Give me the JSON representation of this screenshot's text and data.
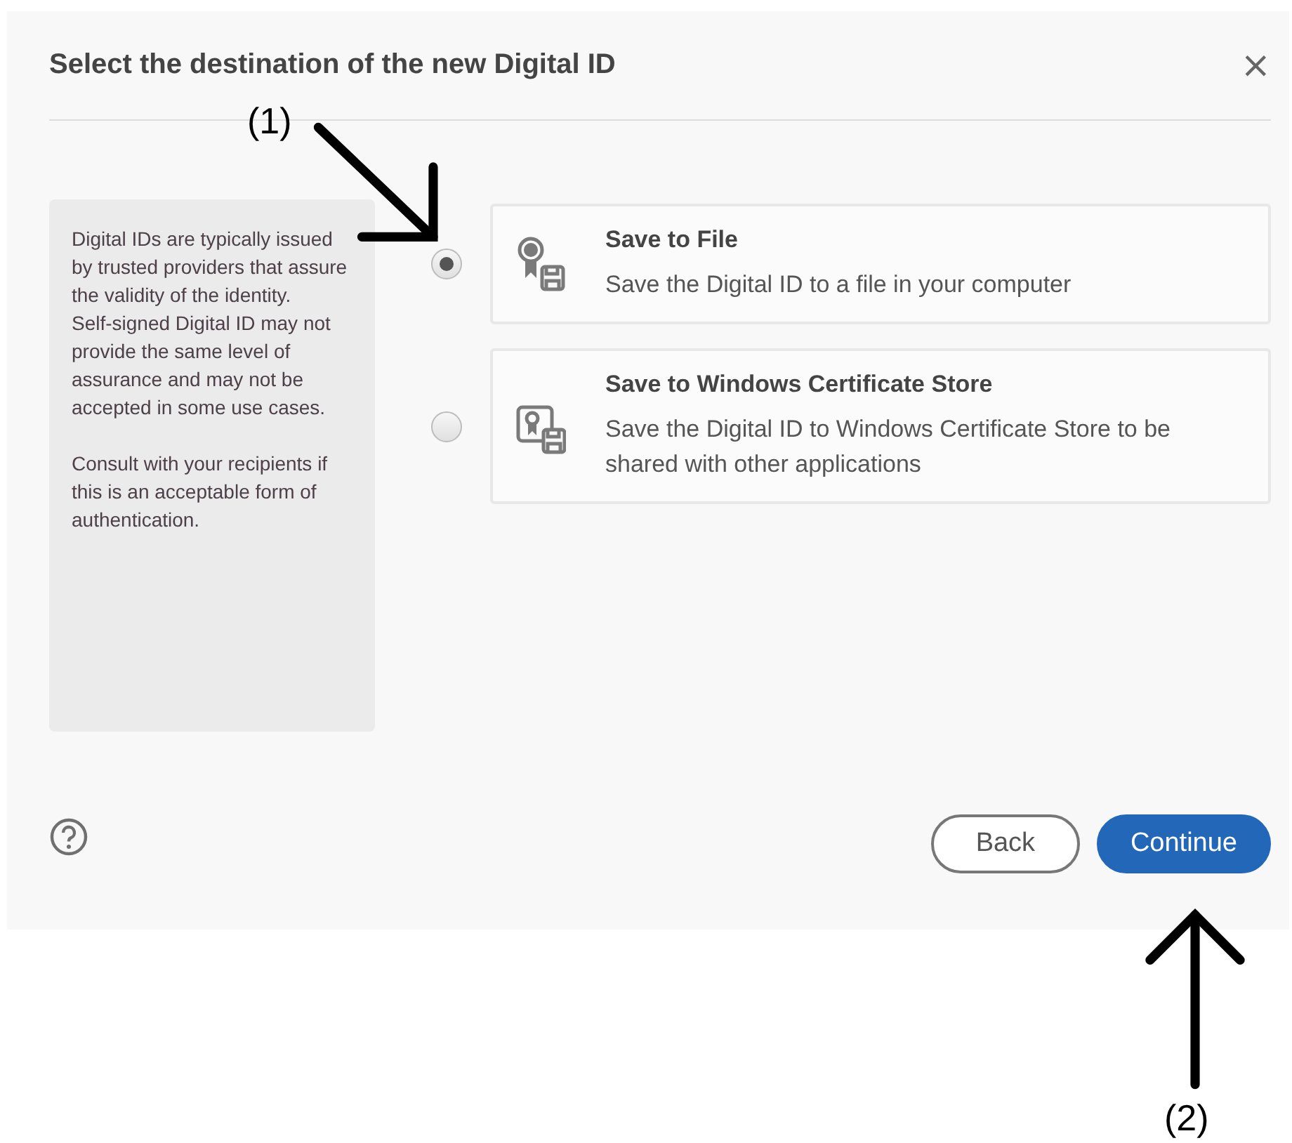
{
  "dialog": {
    "title": "Select the destination of the new Digital ID",
    "close_glyph": "×"
  },
  "info_panel": {
    "paragraphs": [
      "Digital IDs are typically issued by trusted providers that assure the validity of the identity.",
      "Self-signed Digital ID may not provide the same level of assurance and may not be accepted in some use cases.",
      "Consult with your recipients if this is an acceptable form of authentication."
    ]
  },
  "options": [
    {
      "kind": "file",
      "title": "Save to File",
      "description": "Save the Digital ID to a file in your computer",
      "selected": true
    },
    {
      "kind": "store",
      "title": "Save to Windows Certificate Store",
      "description": "Save the Digital ID to Windows Certificate Store to be shared with other applications",
      "selected": false
    }
  ],
  "buttons": [
    {
      "kind": "secondary",
      "label": "Back"
    },
    {
      "kind": "primary",
      "label": "Continue"
    }
  ],
  "annotations": [
    {
      "kind": "down-right",
      "label": "(1)"
    },
    {
      "kind": "up",
      "label": "(2)"
    }
  ]
}
